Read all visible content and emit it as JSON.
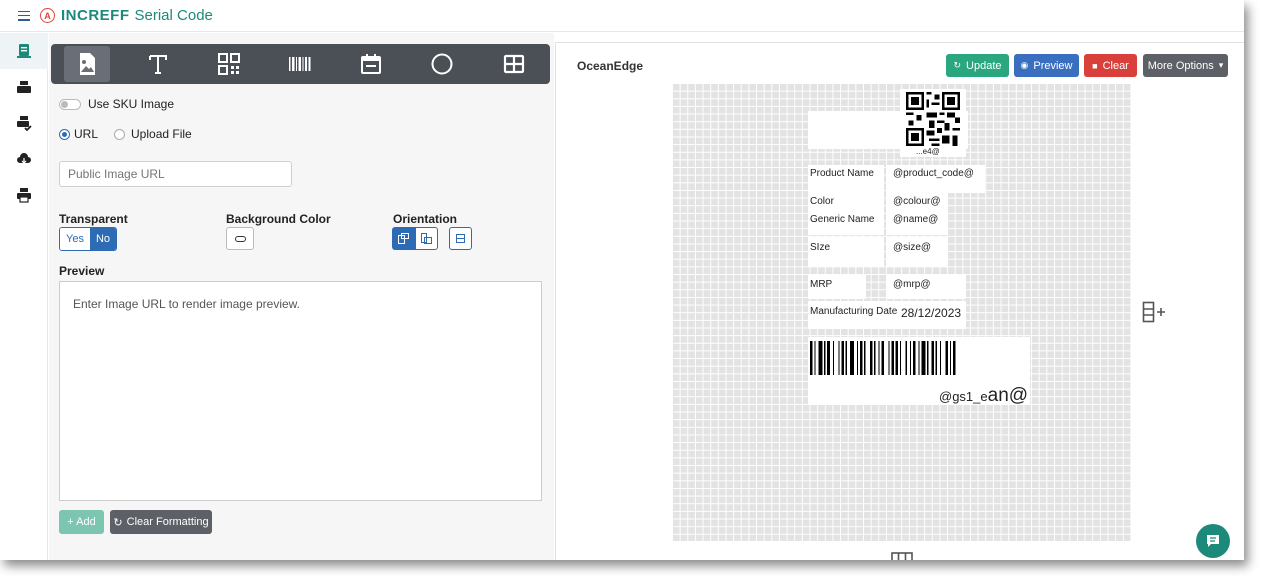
{
  "header": {
    "brand": "INCREFF",
    "app_title": "Serial Code"
  },
  "rail": [
    {
      "name": "rail-item-templates",
      "icon": "document-icon",
      "active": true
    },
    {
      "name": "rail-item-printers",
      "icon": "printer-icon"
    },
    {
      "name": "rail-item-print-check",
      "icon": "printer-check-icon"
    },
    {
      "name": "rail-item-cloud",
      "icon": "cloud-icon"
    },
    {
      "name": "rail-item-print",
      "icon": "print-icon"
    }
  ],
  "toolbar": {
    "tools": [
      "image-tool",
      "text-tool",
      "qr-tool",
      "barcode-tool",
      "date-tool",
      "shape-tool",
      "table-tool"
    ],
    "active": "image-tool"
  },
  "form": {
    "use_sku_label": "Use SKU Image",
    "source_url_label": "URL",
    "source_upload_label": "Upload File",
    "url_placeholder": "Public Image URL",
    "transparent_label": "Transparent",
    "transparent_yes": "Yes",
    "transparent_no": "No",
    "bg_color_label": "Background Color",
    "orientation_label": "Orientation",
    "preview_label": "Preview",
    "preview_hint": "Enter Image URL to render image preview.",
    "add_label": "+ Add",
    "clear_formatting_label": "Clear Formatting"
  },
  "right": {
    "title": "OceanEdge",
    "update_label": "Update",
    "preview_label": "Preview",
    "clear_label": "Clear",
    "more_options_label": "More Options",
    "colors": {
      "update": "#2aa77e",
      "preview": "#3a6fc0",
      "clear": "#d9403b",
      "more": "#5d6066"
    }
  },
  "label": {
    "qr_caption": "...e4@",
    "rows": [
      {
        "key": "Product Name",
        "value": "@product_code@"
      },
      {
        "key": "Color",
        "value": "@colour@"
      },
      {
        "key": "Generic Name",
        "value": "@name@"
      },
      {
        "key": "SIze",
        "value": "@size@"
      },
      {
        "key": "MRP",
        "value": "@mrp@"
      },
      {
        "key": "Manufacturing Date",
        "value": "28/12/2023"
      }
    ],
    "barcode_text_small": "@gs1_e",
    "barcode_text_large": "an@"
  }
}
